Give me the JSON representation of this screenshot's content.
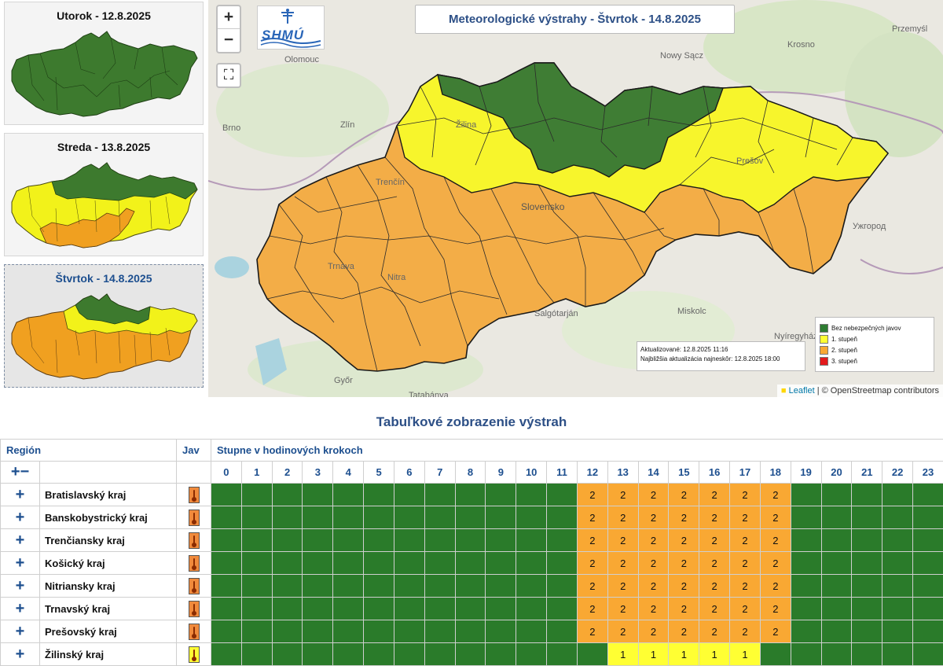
{
  "thumbnails": [
    {
      "title": "Utorok - 12.8.2025"
    },
    {
      "title": "Streda - 13.8.2025"
    },
    {
      "title": "Štvrtok - 14.8.2025"
    }
  ],
  "map": {
    "zoom_in": "+",
    "zoom_out": "−",
    "fullscreen": "⛶",
    "logo_text": "SHMÚ",
    "title": "Meteorologické výstrahy - Štvrtok - 14.8.2025",
    "cities": [
      "Olomouc",
      "Brno",
      "Zlín",
      "Žilina",
      "Trenčín",
      "Nowy Sącz",
      "Krosno",
      "Przemyśl",
      "Prešov",
      "Slovensko",
      "Nitra",
      "Trnava",
      "Salgótarján",
      "Miskolc",
      "Nyíregyháza",
      "Győr",
      "Tatabánya",
      "Ужгород"
    ],
    "updated": "Aktualizované: 12.8.2025 11:16",
    "next_update": "Najbližšia aktualizácia najneskôr: 12.8.2025 18:00",
    "legend": [
      {
        "label": "Bez nebezpečných javov",
        "color": "#2e7d32"
      },
      {
        "label": "1. stupeň",
        "color": "#ffff33"
      },
      {
        "label": "2. stupeň",
        "color": "#f9a833"
      },
      {
        "label": "3. stupeň",
        "color": "#e31a1c"
      }
    ],
    "attribution_leaflet": "Leaflet",
    "attribution_rest": "| © OpenStreetmap contributors"
  },
  "table": {
    "title": "Tabuľkové zobrazenie výstrah",
    "col_region": "Región",
    "col_jav": "Jav",
    "col_steps": "Stupne v hodinových krokoch",
    "expand_collapse": "+−",
    "hours": [
      "0",
      "1",
      "2",
      "3",
      "4",
      "5",
      "6",
      "7",
      "8",
      "9",
      "10",
      "11",
      "12",
      "13",
      "14",
      "15",
      "16",
      "17",
      "18",
      "19",
      "20",
      "21",
      "22",
      "23"
    ],
    "rows": [
      {
        "name": "Bratislavský kraj",
        "jav_color": "#f08a3c",
        "levels": [
          0,
          0,
          0,
          0,
          0,
          0,
          0,
          0,
          0,
          0,
          0,
          0,
          2,
          2,
          2,
          2,
          2,
          2,
          2,
          0,
          0,
          0,
          0,
          0
        ]
      },
      {
        "name": "Banskobystrický kraj",
        "jav_color": "#f08a3c",
        "levels": [
          0,
          0,
          0,
          0,
          0,
          0,
          0,
          0,
          0,
          0,
          0,
          0,
          2,
          2,
          2,
          2,
          2,
          2,
          2,
          0,
          0,
          0,
          0,
          0
        ]
      },
      {
        "name": "Trenčiansky kraj",
        "jav_color": "#f08a3c",
        "levels": [
          0,
          0,
          0,
          0,
          0,
          0,
          0,
          0,
          0,
          0,
          0,
          0,
          2,
          2,
          2,
          2,
          2,
          2,
          2,
          0,
          0,
          0,
          0,
          0
        ]
      },
      {
        "name": "Košický kraj",
        "jav_color": "#f08a3c",
        "levels": [
          0,
          0,
          0,
          0,
          0,
          0,
          0,
          0,
          0,
          0,
          0,
          0,
          2,
          2,
          2,
          2,
          2,
          2,
          2,
          0,
          0,
          0,
          0,
          0
        ]
      },
      {
        "name": "Nitriansky kraj",
        "jav_color": "#f08a3c",
        "levels": [
          0,
          0,
          0,
          0,
          0,
          0,
          0,
          0,
          0,
          0,
          0,
          0,
          2,
          2,
          2,
          2,
          2,
          2,
          2,
          0,
          0,
          0,
          0,
          0
        ]
      },
      {
        "name": "Trnavský kraj",
        "jav_color": "#f08a3c",
        "levels": [
          0,
          0,
          0,
          0,
          0,
          0,
          0,
          0,
          0,
          0,
          0,
          0,
          2,
          2,
          2,
          2,
          2,
          2,
          2,
          0,
          0,
          0,
          0,
          0
        ]
      },
      {
        "name": "Prešovský kraj",
        "jav_color": "#f08a3c",
        "levels": [
          0,
          0,
          0,
          0,
          0,
          0,
          0,
          0,
          0,
          0,
          0,
          0,
          2,
          2,
          2,
          2,
          2,
          2,
          2,
          0,
          0,
          0,
          0,
          0
        ]
      },
      {
        "name": "Žilinský kraj",
        "jav_color": "#ffff33",
        "levels": [
          0,
          0,
          0,
          0,
          0,
          0,
          0,
          0,
          0,
          0,
          0,
          0,
          0,
          1,
          1,
          1,
          1,
          1,
          0,
          0,
          0,
          0,
          0,
          0
        ]
      }
    ],
    "level_colors": {
      "0": "#2a7b2a",
      "1": "#ffff33",
      "2": "#f9a833"
    }
  }
}
